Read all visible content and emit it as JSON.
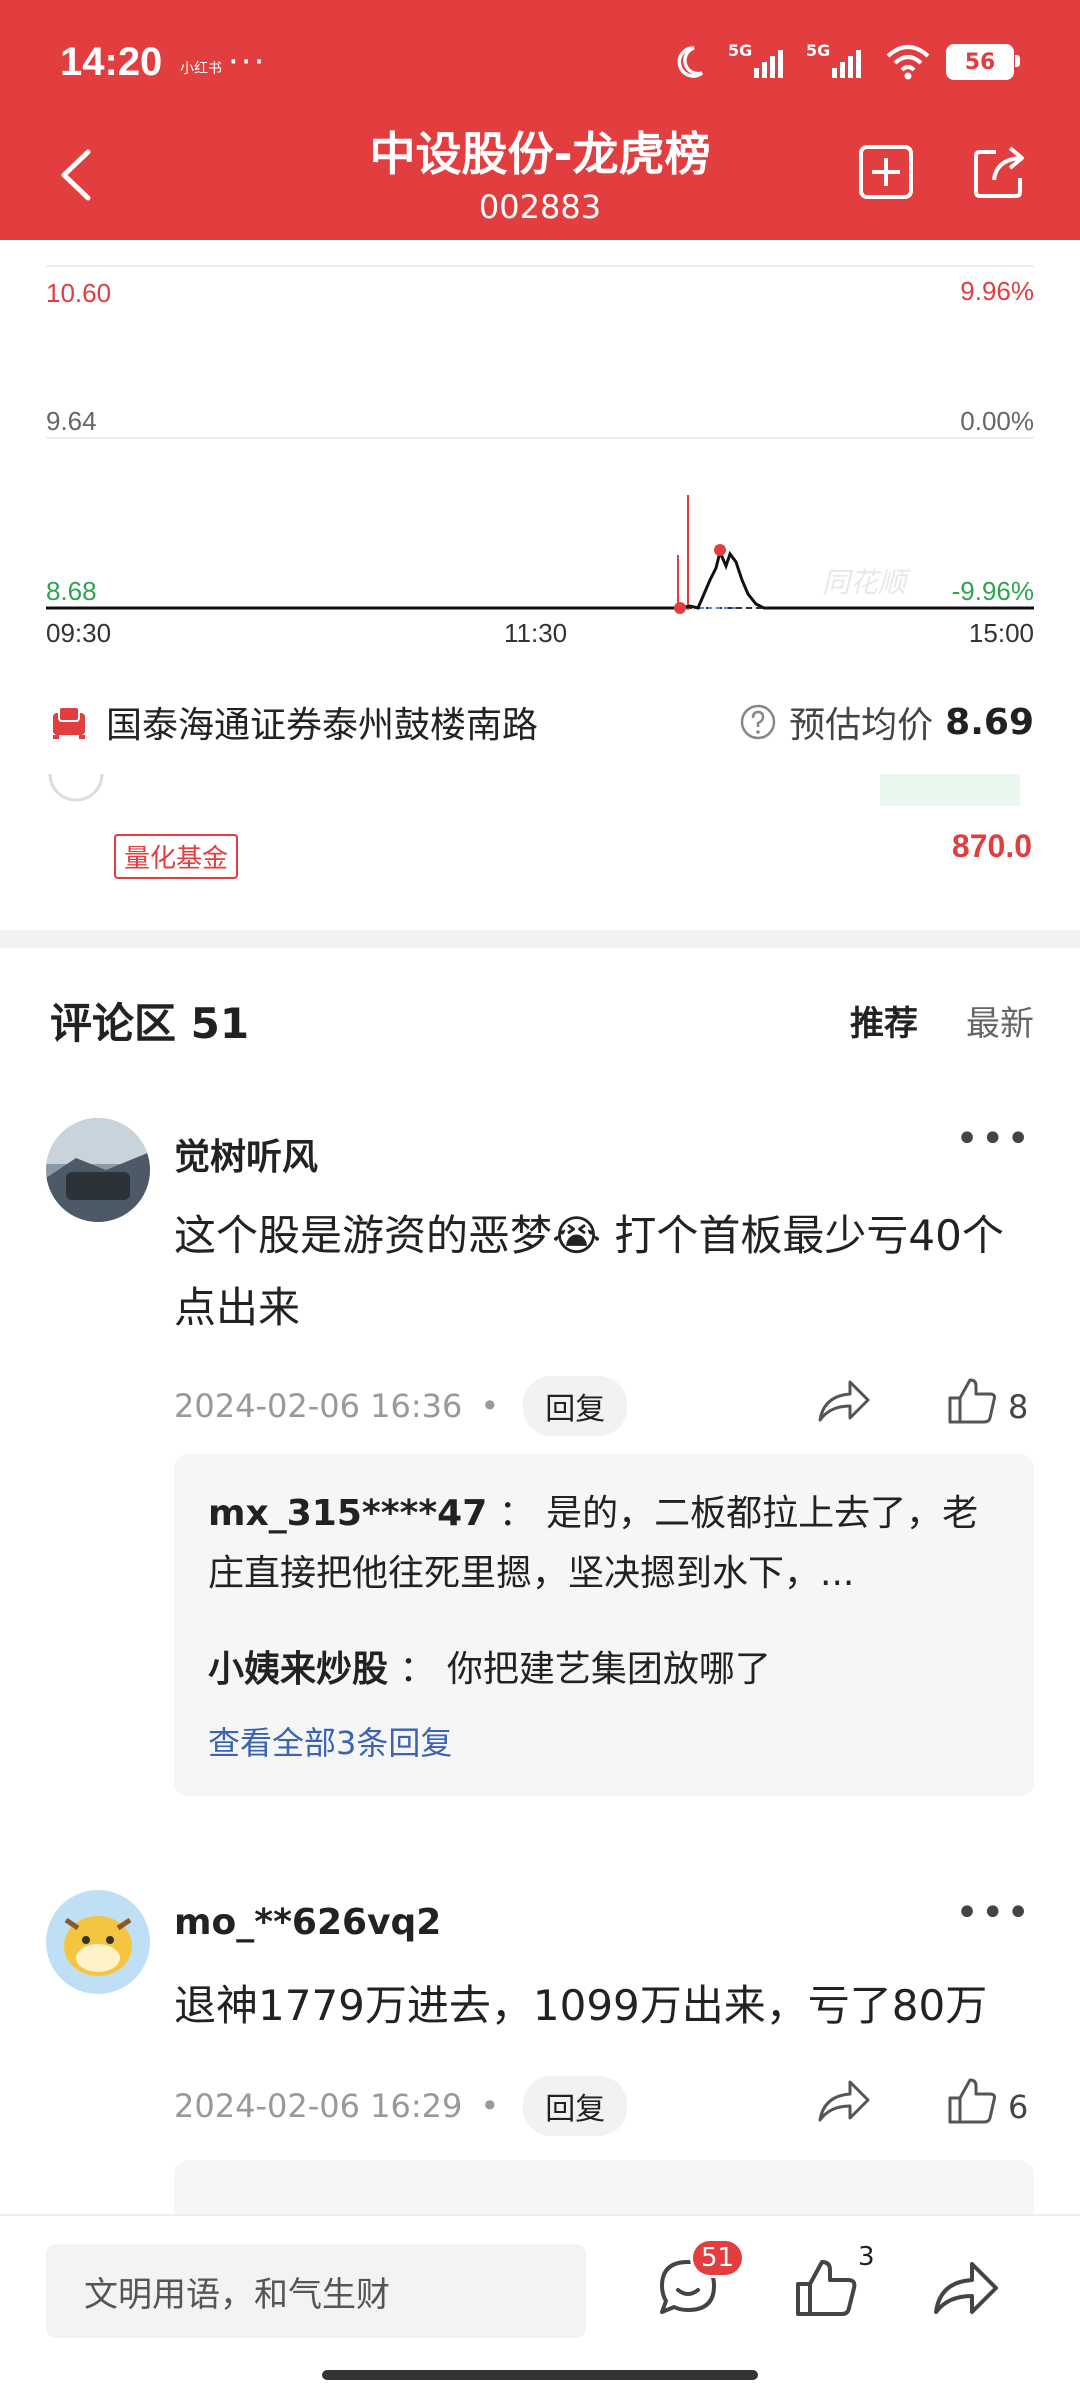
{
  "status_bar": {
    "time": "14:20",
    "carrier_small": "小红书",
    "more_dots": "···",
    "signal_1": "5G",
    "signal_2": "5G",
    "battery": "56"
  },
  "header": {
    "title": "中设股份-龙虎榜",
    "code": "002883"
  },
  "chart": {
    "left_top": "10.60",
    "left_mid": "9.64",
    "left_bottom": "8.68",
    "right_top": "9.96%",
    "right_mid": "0.00%",
    "right_bottom": "-9.96%",
    "time_start": "09:30",
    "time_mid": "11:30",
    "time_end": "15:00",
    "watermark": "同花顺",
    "colors": {
      "up": "#e23d3f",
      "down": "#2ea44f"
    }
  },
  "broker": {
    "name": "国泰海通证券泰州鼓楼南路",
    "est_label": "预估均价",
    "est_value": "8.69"
  },
  "partial_row": {
    "tag": "量化基金",
    "amount": "870.0"
  },
  "comments_section": {
    "title": "评论区 51",
    "sort_recommend": "推荐",
    "sort_latest": "最新"
  },
  "comments": [
    {
      "user": "觉树听风",
      "text": "这个股是游资的恶梦😭 打个首板最少亏40个点出来",
      "time": "2024-02-06 16:36",
      "reply_label": "回复",
      "likes": "8",
      "replies": [
        {
          "user": "mx_315****47",
          "text": "是的，二板都拉上去了，老庄直接把他往死里摁，坚决摁到水下，..."
        },
        {
          "user": "小姨来炒股",
          "text": "你把建艺集团放哪了"
        }
      ],
      "view_all": "查看全部3条回复"
    },
    {
      "user": "mo_**626vq2",
      "text": "退神1779万进去，1099万出来，亏了80万",
      "time": "2024-02-06 16:29",
      "reply_label": "回复",
      "likes": "6"
    }
  ],
  "bottom_bar": {
    "input_placeholder": "文明用语，和气生财",
    "comment_badge": "51",
    "like_count": "3"
  }
}
